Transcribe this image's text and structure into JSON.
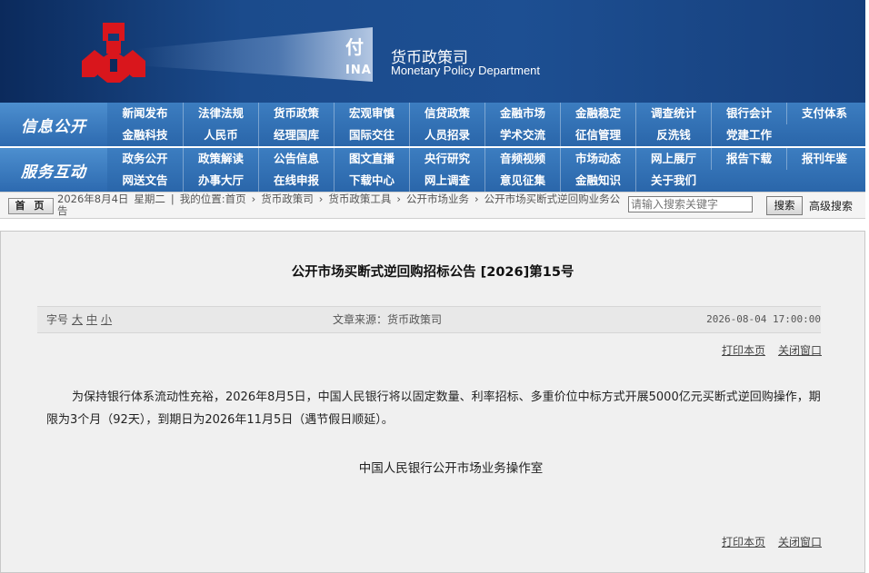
{
  "header": {
    "tag_text": "付",
    "tag_text2": "INA",
    "dept_cn": "货币政策司",
    "dept_en": "Monetary Policy Department"
  },
  "nav": {
    "info_label": "信息公开",
    "info_row1": [
      "新闻发布",
      "法律法规",
      "货币政策",
      "宏观审慎",
      "信贷政策",
      "金融市场",
      "金融稳定",
      "调查统计",
      "银行会计",
      "支付体系"
    ],
    "info_row2": [
      "金融科技",
      "人民币",
      "经理国库",
      "国际交往",
      "人员招录",
      "学术交流",
      "征信管理",
      "反洗钱",
      "党建工作"
    ],
    "service_label": "服务互动",
    "service_row1": [
      "政务公开",
      "政策解读",
      "公告信息",
      "图文直播",
      "央行研究",
      "音频视频",
      "市场动态",
      "网上展厅",
      "报告下载",
      "报刊年鉴"
    ],
    "service_row2": [
      "网送文告",
      "办事大厅",
      "在线申报",
      "下载中心",
      "网上调查",
      "意见征集",
      "金融知识",
      "关于我们"
    ]
  },
  "crumb": {
    "home": "首 页",
    "date": "2026年8月4日",
    "weekday": "星期二",
    "location_prefix": "我的位置:首页",
    "items": [
      "货币政策司",
      "货币政策工具",
      "公开市场业务",
      "公开市场买断式逆回购业务公告"
    ],
    "search_placeholder": "请输入搜索关键字",
    "search_btn": "搜索",
    "advanced": "高级搜索"
  },
  "article": {
    "title": "公开市场买断式逆回购招标公告 [2026]第15号",
    "font_label": "字号",
    "font_large": "大",
    "font_medium": "中",
    "font_small": "小",
    "source": "文章来源：货币政策司",
    "datetime": "2026-08-04 17:00:00",
    "print": "打印本页",
    "close": "关闭窗口",
    "body": "为保持银行体系流动性充裕，2026年8月5日，中国人民银行将以固定数量、利率招标、多重价位中标方式开展5000亿元买断式逆回购操作，期限为3个月（92天），到期日为2026年11月5日（遇节假日顺延）。",
    "signature": "中国人民银行公开市场业务操作室"
  }
}
